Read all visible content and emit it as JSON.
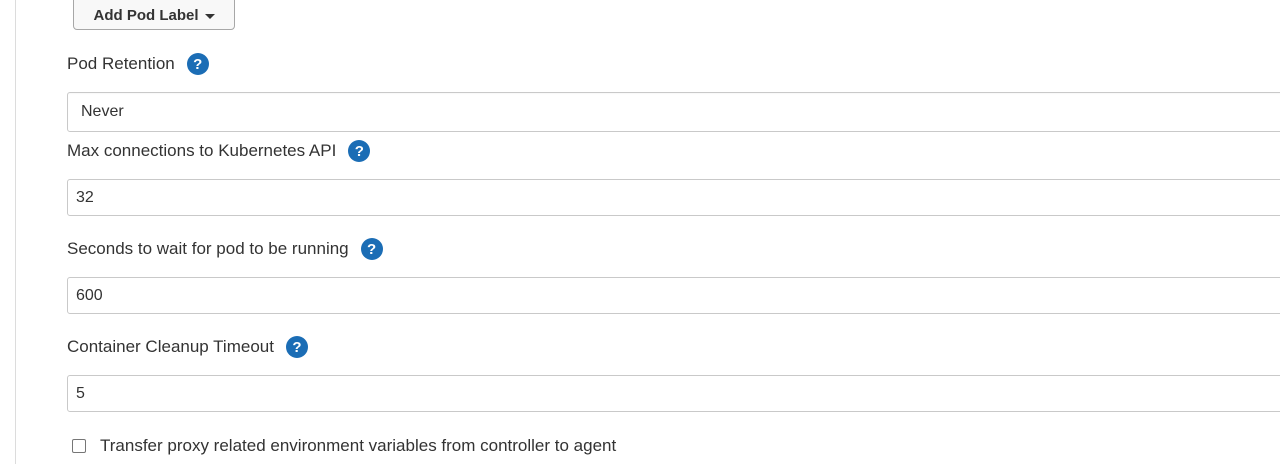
{
  "add_pod_label": {
    "label": "Add Pod Label"
  },
  "pod_retention": {
    "label": "Pod Retention",
    "help": "?",
    "selected": "Never"
  },
  "max_connections": {
    "label": "Max connections to Kubernetes API",
    "help": "?",
    "value": "32"
  },
  "seconds_wait": {
    "label": "Seconds to wait for pod to be running",
    "help": "?",
    "value": "600"
  },
  "container_cleanup": {
    "label": "Container Cleanup Timeout",
    "help": "?",
    "value": "5"
  },
  "transfer_proxy": {
    "label": "Transfer proxy related environment variables from controller to agent",
    "checked": false
  },
  "colors": {
    "help_icon": "#1b6db5",
    "border": "#c9c9c9",
    "text": "#333333"
  }
}
